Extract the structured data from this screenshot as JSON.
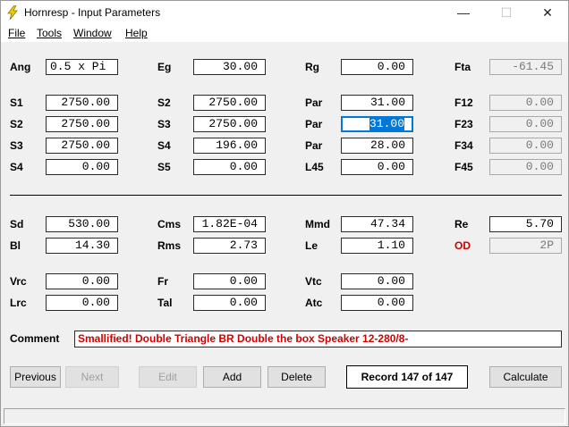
{
  "window": {
    "title": "Hornresp - Input Parameters",
    "minimize": "—",
    "maximize": "☐",
    "close": "✕"
  },
  "menu": {
    "file": "File",
    "tools": "Tools",
    "window": "Window",
    "help": "Help"
  },
  "params": {
    "ang": {
      "label": "Ang",
      "value": "0.5 x Pi"
    },
    "eg": {
      "label": "Eg",
      "value": "30.00"
    },
    "rg": {
      "label": "Rg",
      "value": "0.00"
    },
    "fta": {
      "label": "Fta",
      "value": "-61.45"
    },
    "s1": {
      "label": "S1",
      "value": "2750.00"
    },
    "s2a": {
      "label": "S2",
      "value": "2750.00"
    },
    "par1": {
      "label": "Par",
      "value": "31.00"
    },
    "f12": {
      "label": "F12",
      "value": "0.00"
    },
    "s2b": {
      "label": "S2",
      "value": "2750.00"
    },
    "s3a": {
      "label": "S3",
      "value": "2750.00"
    },
    "par2": {
      "label": "Par",
      "value": "31.00"
    },
    "f23": {
      "label": "F23",
      "value": "0.00"
    },
    "s3b": {
      "label": "S3",
      "value": "2750.00"
    },
    "s4a": {
      "label": "S4",
      "value": "196.00"
    },
    "par3": {
      "label": "Par",
      "value": "28.00"
    },
    "f34": {
      "label": "F34",
      "value": "0.00"
    },
    "s4b": {
      "label": "S4",
      "value": "0.00"
    },
    "s5": {
      "label": "S5",
      "value": "0.00"
    },
    "l45": {
      "label": "L45",
      "value": "0.00"
    },
    "f45": {
      "label": "F45",
      "value": "0.00"
    },
    "sd": {
      "label": "Sd",
      "value": "530.00"
    },
    "cms": {
      "label": "Cms",
      "value": "1.82E-04"
    },
    "mmd": {
      "label": "Mmd",
      "value": "47.34"
    },
    "re": {
      "label": "Re",
      "value": "5.70"
    },
    "bl": {
      "label": "Bl",
      "value": "14.30"
    },
    "rms": {
      "label": "Rms",
      "value": "2.73"
    },
    "le": {
      "label": "Le",
      "value": "1.10"
    },
    "od": {
      "label": "OD",
      "value": "2P"
    },
    "vrc": {
      "label": "Vrc",
      "value": "0.00"
    },
    "fr": {
      "label": "Fr",
      "value": "0.00"
    },
    "vtc": {
      "label": "Vtc",
      "value": "0.00"
    },
    "lrc": {
      "label": "Lrc",
      "value": "0.00"
    },
    "tal": {
      "label": "Tal",
      "value": "0.00"
    },
    "atc": {
      "label": "Atc",
      "value": "0.00"
    }
  },
  "comment": {
    "label": "Comment",
    "value": "Smallified! Double Triangle BR Double the box Speaker 12-280/8-"
  },
  "buttons": {
    "previous": "Previous",
    "next": "Next",
    "edit": "Edit",
    "add": "Add",
    "delete": "Delete",
    "calculate": "Calculate"
  },
  "record": "Record 147 of 147",
  "colors": {
    "selection": "#0078d7",
    "warning_text": "#d00000"
  }
}
